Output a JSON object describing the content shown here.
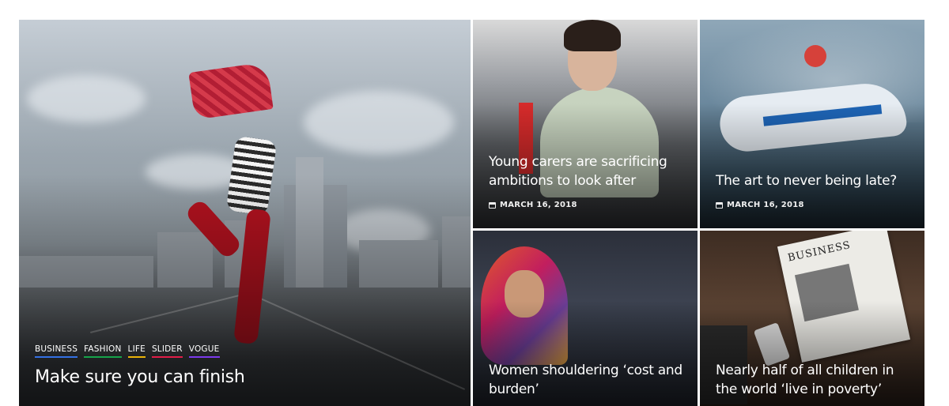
{
  "hero": {
    "categories": [
      {
        "label": "BUSINESS",
        "color": "#3470e4"
      },
      {
        "label": "FASHION",
        "color": "#16a34a"
      },
      {
        "label": "LIFE",
        "color": "#eab308"
      },
      {
        "label": "SLIDER",
        "color": "#e11d48"
      },
      {
        "label": "VOGUE",
        "color": "#7c3aed"
      }
    ],
    "title": "Make sure you can finish"
  },
  "cards": [
    {
      "title": "Young carers are sacrificing ambitions to look after",
      "date": "MARCH 16, 2018"
    },
    {
      "title": "The art to never being late?",
      "date": "MARCH 16, 2018"
    },
    {
      "title": "Women shouldering ‘cost and burden’"
    },
    {
      "title": "Nearly half of all children in the world ‘live in poverty’"
    }
  ],
  "decor": {
    "newspaper_masthead": "BUSINESS"
  }
}
